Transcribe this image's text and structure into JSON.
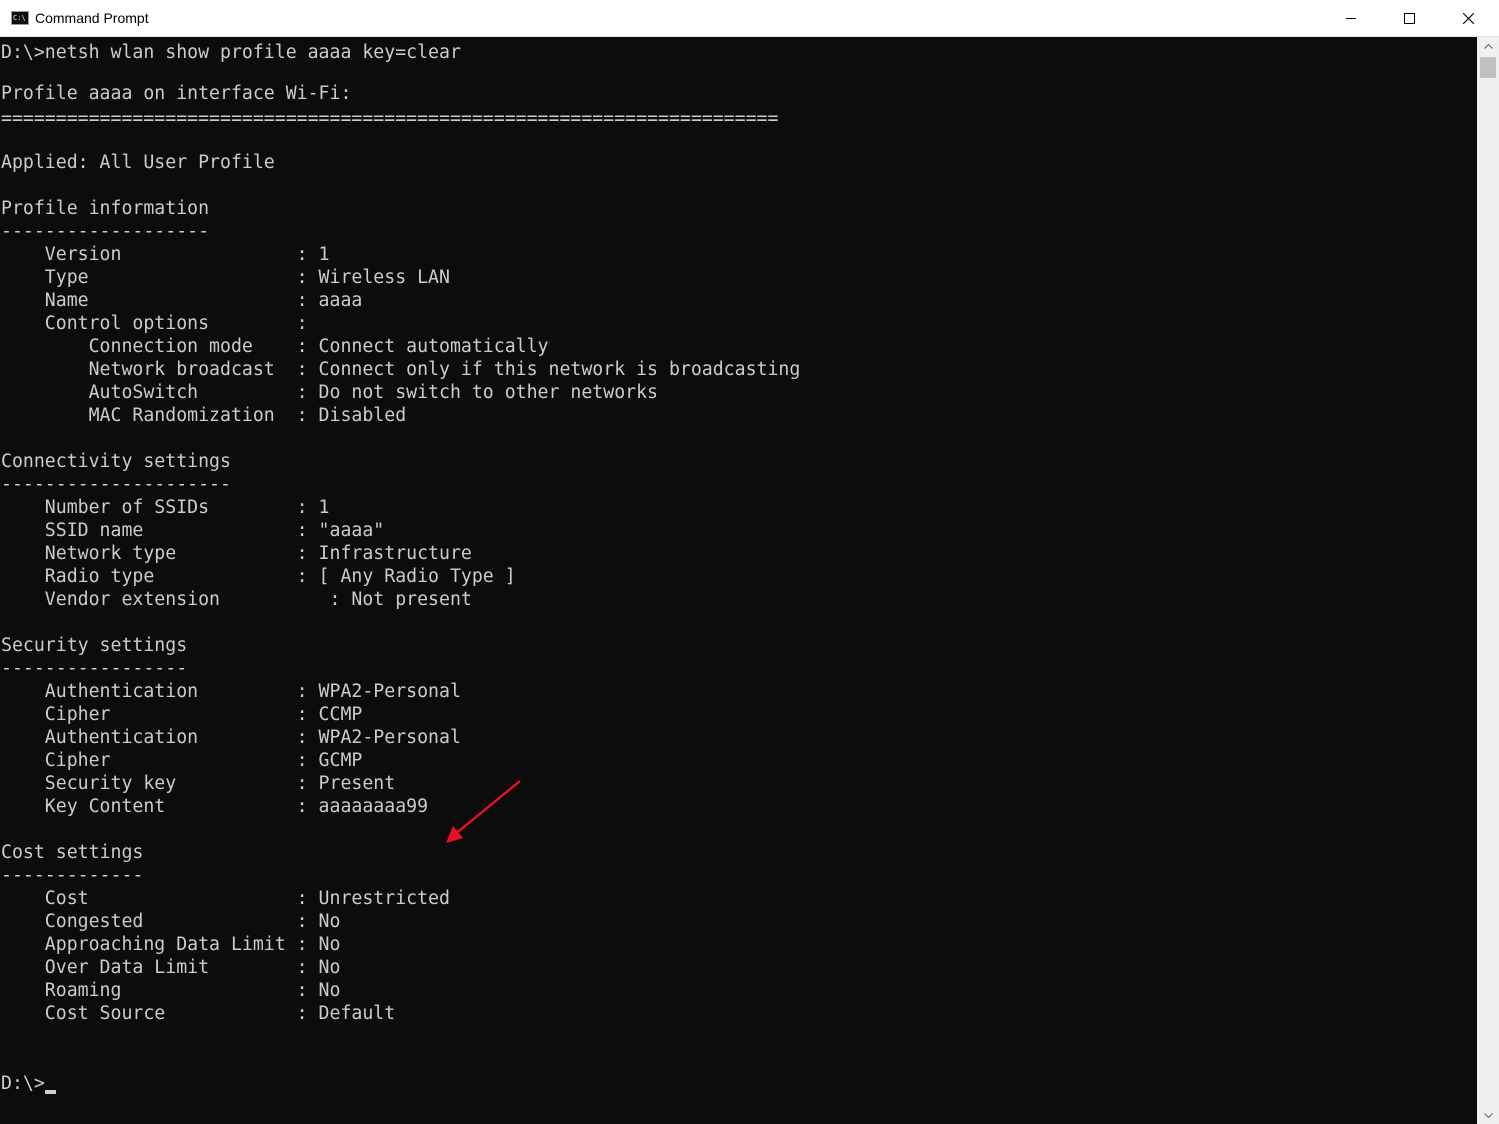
{
  "window": {
    "title": "Command Prompt",
    "icon": "cmd-icon",
    "icon_text": "C:\\",
    "controls": {
      "minimize_icon": "minimize-icon",
      "maximize_icon": "maximize-icon",
      "close_icon": "close-icon"
    }
  },
  "console": {
    "lines": [
      "D:\\>netsh wlan show profile aaaa key=clear",
      "",
      "Profile aaaa on interface Wi-Fi:",
      "=======================================================================",
      "",
      "Applied: All User Profile",
      "",
      "Profile information",
      "-------------------",
      "    Version                : 1",
      "    Type                   : Wireless LAN",
      "    Name                   : aaaa",
      "    Control options        :",
      "        Connection mode    : Connect automatically",
      "        Network broadcast  : Connect only if this network is broadcasting",
      "        AutoSwitch         : Do not switch to other networks",
      "        MAC Randomization  : Disabled",
      "",
      "Connectivity settings",
      "---------------------",
      "    Number of SSIDs        : 1",
      "    SSID name              : \"aaaa\"",
      "    Network type           : Infrastructure",
      "    Radio type             : [ Any Radio Type ]",
      "    Vendor extension          : Not present",
      "",
      "Security settings",
      "-----------------",
      "    Authentication         : WPA2-Personal",
      "    Cipher                 : CCMP",
      "    Authentication         : WPA2-Personal",
      "    Cipher                 : GCMP",
      "    Security key           : Present",
      "    Key Content            : aaaaaaaa99",
      "",
      "Cost settings",
      "-------------",
      "    Cost                   : Unrestricted",
      "    Congested              : No",
      "    Approaching Data Limit : No",
      "    Over Data Limit        : No",
      "    Roaming                : No",
      "    Cost Source            : Default",
      "",
      "",
      "D:\\>"
    ]
  },
  "annotation": {
    "arrow_color": "#e81123",
    "arrow_icon": "red-arrow-icon"
  },
  "colors": {
    "console_bg": "#0c0c0c",
    "console_text": "#cccccc",
    "titlebar_bg": "#ffffff"
  }
}
